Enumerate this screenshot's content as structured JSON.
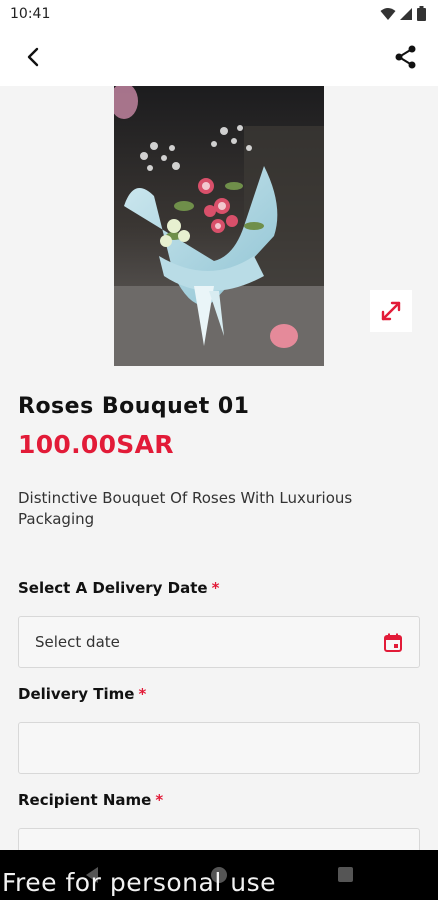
{
  "status_bar": {
    "time": "10:41"
  },
  "product": {
    "title": "Roses Bouquet 01",
    "price": "100.00SAR",
    "description": "Distinctive Bouquet Of Roses With Luxurious Packaging"
  },
  "form": {
    "delivery_date": {
      "label": "Select A Delivery Date",
      "required_mark": "*",
      "placeholder": "Select date"
    },
    "delivery_time": {
      "label": "Delivery Time",
      "required_mark": "*",
      "value": ""
    },
    "recipient_name": {
      "label": "Recipient Name",
      "required_mark": "*",
      "value": ""
    }
  },
  "watermark": "Free for personal use",
  "colors": {
    "accent": "#e21b38",
    "background": "#f4f4f4"
  },
  "icons": [
    "wifi-icon",
    "signal-icon",
    "battery-icon",
    "back-arrow-icon",
    "share-icon",
    "expand-icon",
    "calendar-icon"
  ]
}
